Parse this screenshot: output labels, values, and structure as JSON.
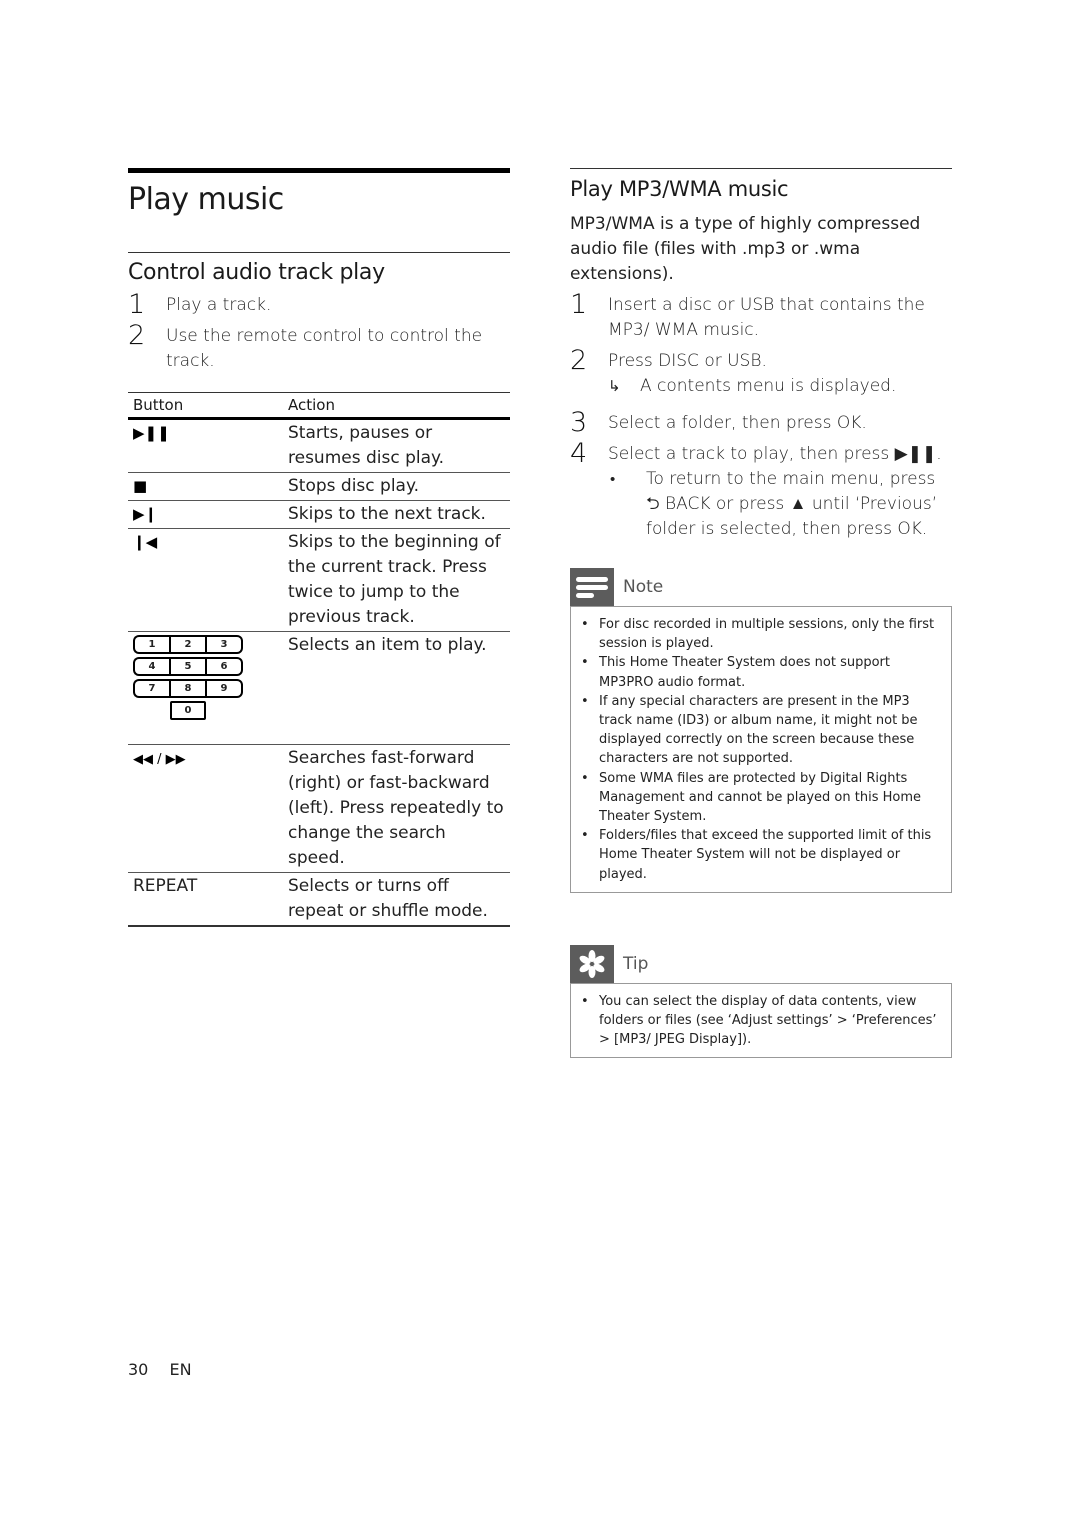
{
  "left": {
    "title": "Play music",
    "section_title": "Control audio track play",
    "steps": [
      {
        "num": "1",
        "text": "Play a track."
      },
      {
        "num": "2",
        "text": "Use the remote control to control the track."
      }
    ],
    "table": {
      "headers": [
        "Button",
        "Action"
      ],
      "rows": [
        {
          "button_icon": "play-pause-icon",
          "button": "▶❚❚",
          "action": "Starts, pauses or resumes disc play."
        },
        {
          "button_icon": "stop-icon",
          "button": "■",
          "action": "Stops disc play."
        },
        {
          "button_icon": "next-track-icon",
          "button": "▶❙",
          "action": "Skips to the next track."
        },
        {
          "button_icon": "previous-track-icon",
          "button": "❙◀",
          "action": "Skips to the beginning of the current track. Press twice to jump to the previous track."
        },
        {
          "button_icon": "numeric-keypad-icon",
          "keypad": [
            [
              "1",
              "2",
              "3"
            ],
            [
              "4",
              "5",
              "6"
            ],
            [
              "7",
              "8",
              "9"
            ],
            [
              "0"
            ]
          ],
          "action": "Selects an item to play."
        },
        {
          "button_icon": "rewind-fastforward-icon",
          "button": "◀◀ / ▶▶",
          "action": "Searches fast-forward (right) or fast-backward (left). Press repeatedly to change the search speed."
        },
        {
          "button": "REPEAT",
          "action": "Selects or turns off repeat or shuffle mode."
        }
      ]
    }
  },
  "right": {
    "section_title": "Play MP3/WMA music",
    "intro": "MP3/WMA is a type of highly compressed audio file (files with .mp3 or .wma extensions).",
    "steps": [
      {
        "num": "1",
        "text": "Insert a disc or USB that contains the MP3/ WMA music."
      },
      {
        "num": "2",
        "text": "Press DISC or USB.",
        "result": "A contents menu is displayed."
      },
      {
        "num": "3",
        "text": "Select a folder, then press OK."
      },
      {
        "num": "4",
        "text": "Select a track to play, then press ▶❚❚.",
        "bullet": "To return to the main menu, press ⮌ BACK or press ▲ until ‘Previous’ folder is selected, then press OK."
      }
    ],
    "note": {
      "label": "Note",
      "items": [
        "For disc recorded in multiple sessions, only the first session is played.",
        "This Home Theater System does not support MP3PRO audio format.",
        "If any special characters are present in the MP3 track name (ID3) or album name, it might not be displayed correctly on the screen because these characters are not supported.",
        "Some WMA files are protected by Digital Rights Management and cannot be played on this Home Theater System.",
        "Folders/files that exceed the supported limit of this Home Theater System will not be displayed or played."
      ]
    },
    "tip": {
      "label": "Tip",
      "items": [
        "You can select the display of data contents, view folders or files (see ‘Adjust settings’ > ‘Preferences’ > [MP3/ JPEG Display])."
      ]
    }
  },
  "footer": {
    "page_number": "30",
    "language": "EN"
  }
}
